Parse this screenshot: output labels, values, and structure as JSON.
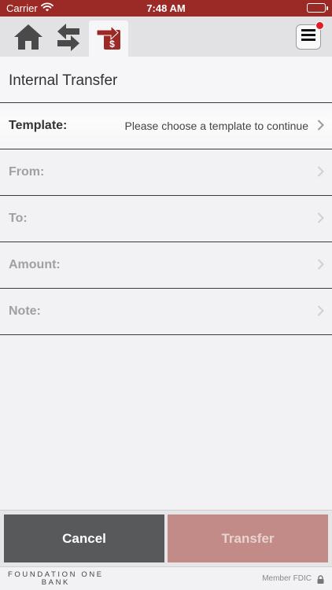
{
  "status_bar": {
    "carrier": "Carrier",
    "time": "7:48 AM"
  },
  "nav": {
    "home_icon": "home-icon",
    "transfers_icon": "swap-arrows-icon",
    "internal_transfer_icon": "transfer-dollar-icon",
    "menu_icon": "hamburger-menu-icon",
    "accent_color": "#9b2a26",
    "notification_color": "#e11d25"
  },
  "page": {
    "title": "Internal Transfer"
  },
  "form": {
    "template_label": "Template:",
    "template_value": "Please choose a template to continue",
    "from_label": "From:",
    "to_label": "To:",
    "amount_label": "Amount:",
    "note_label": "Note:"
  },
  "buttons": {
    "cancel": "Cancel",
    "transfer": "Transfer"
  },
  "footer": {
    "logo_line1": "FOUNDATION ONE",
    "logo_line2": "BANK",
    "fdic": "Member FDIC"
  }
}
